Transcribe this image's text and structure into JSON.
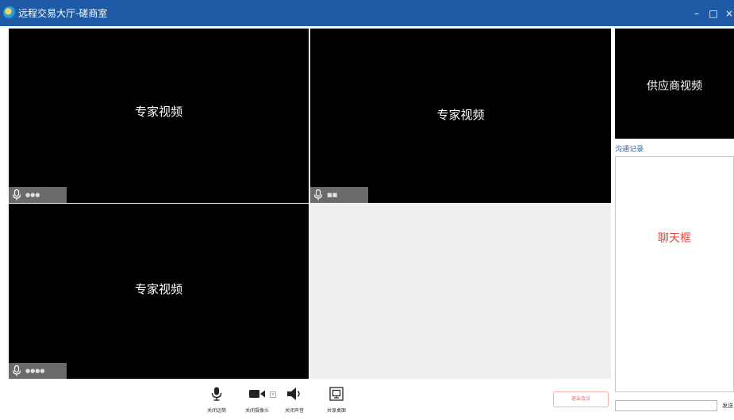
{
  "window": {
    "title": "远程交易大厅-磋商室",
    "controls": {
      "minimize": "–",
      "maximize": "□",
      "close": "×"
    },
    "accent_color": "#1f5aa6"
  },
  "videos": {
    "experts": [
      {
        "label": "专家视频",
        "name_tag": "●●●"
      },
      {
        "label": "专家视频",
        "name_tag": "■■"
      },
      {
        "label": "专家视频",
        "name_tag": "●●●●"
      }
    ],
    "supplier": {
      "label": "供应商视频"
    }
  },
  "chat": {
    "section_label": "沟通记录",
    "placeholder": "聊天框",
    "input_value": "",
    "send_label": "发送"
  },
  "toolbar": {
    "mute_mic": {
      "label": "关闭话筒",
      "icon": "microphone-icon"
    },
    "camera": {
      "label": "关闭摄像头",
      "icon": "camera-icon"
    },
    "sound": {
      "label": "关闭声音",
      "icon": "speaker-icon"
    },
    "share": {
      "label": "共享桌面",
      "icon": "share-screen-icon"
    },
    "exit": {
      "label": "退出会议"
    }
  }
}
